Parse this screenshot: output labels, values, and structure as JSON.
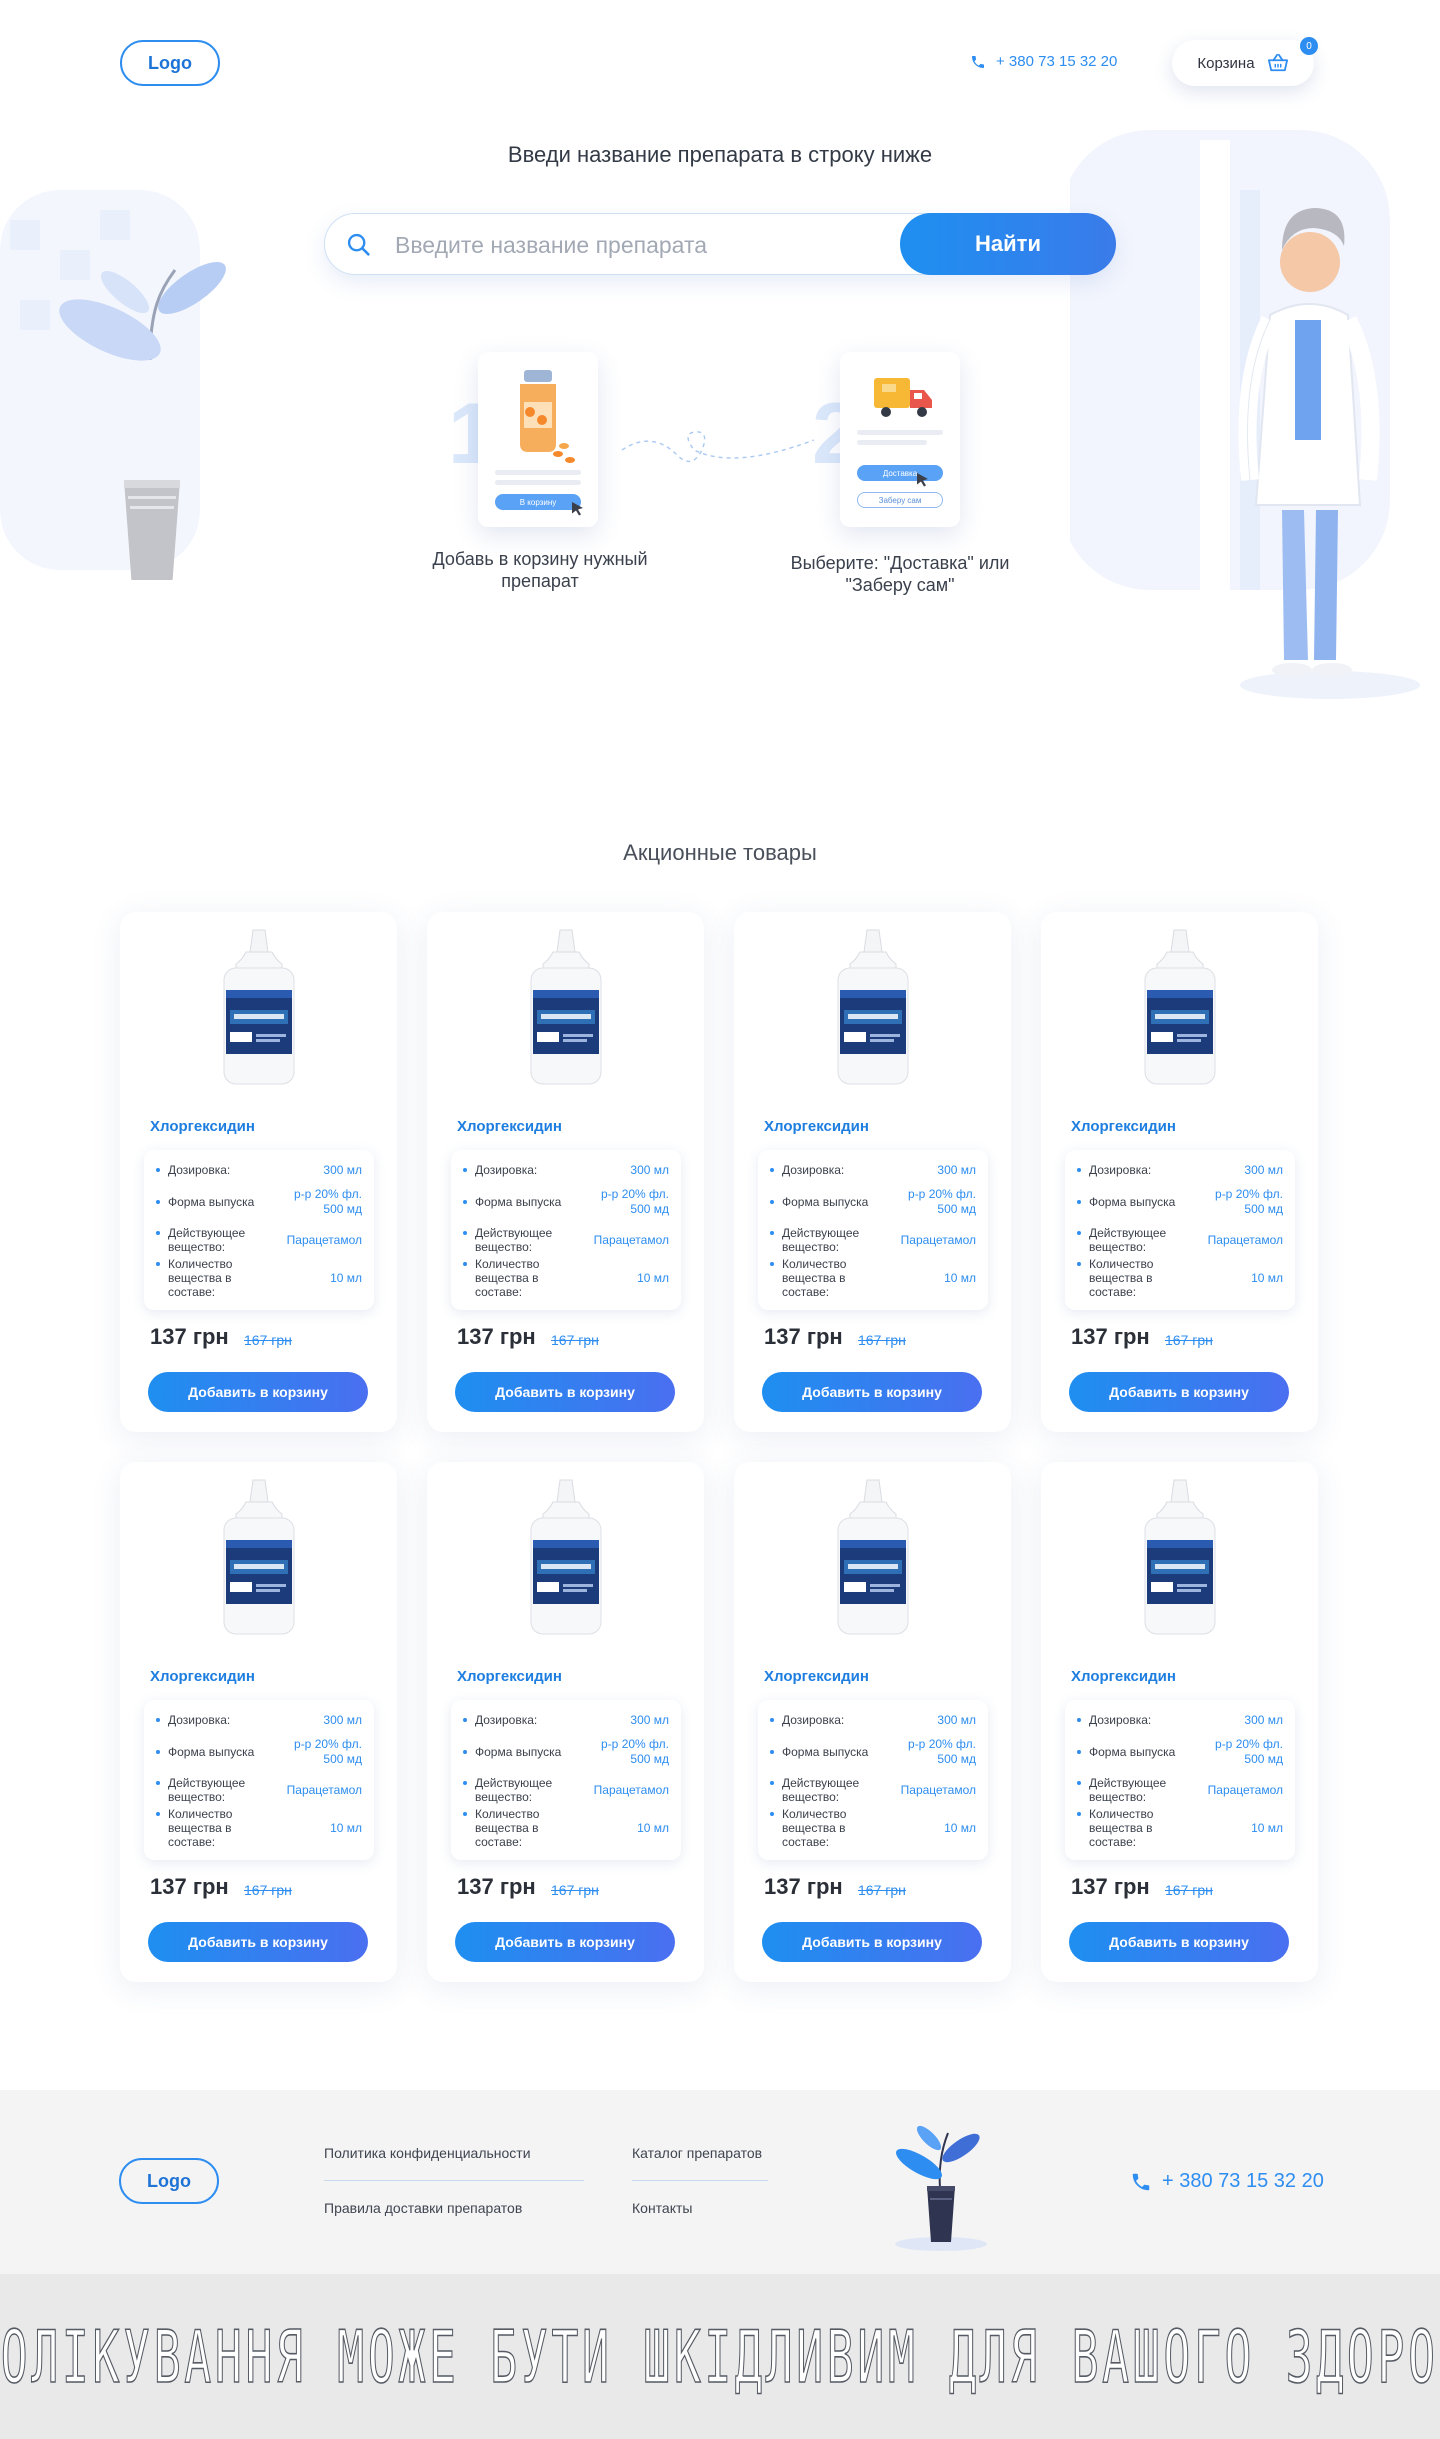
{
  "header": {
    "logo": "Logo",
    "phone": "+ 380 73 15 32 20",
    "cart_label": "Корзина",
    "cart_count": "0"
  },
  "hero": {
    "title": "Введи название препарата в строку ниже",
    "search_placeholder": "Введите название препарата",
    "search_button": "Найти",
    "steps": [
      {
        "number": "1",
        "text": "Добавь в корзину нужный препарат",
        "card_button": "В корзину"
      },
      {
        "number": "2",
        "text": "Выберите: \"Доставка\" или \"Заберу сам\"",
        "card_button": "Доставка",
        "card_button_secondary": "Заберу сам"
      }
    ]
  },
  "products_section": {
    "title": "Акционные товары",
    "spec_labels": {
      "dose": "Дозировка:",
      "form": "Форма выпуска",
      "substance": "Действующее вещество:",
      "amount": "Количество вещества в составе:"
    },
    "add_button": "Добавить в корзину",
    "items": [
      {
        "name": "Хлоргексидин",
        "dose": "300 мл",
        "form": "р-р 20% фл. 500 мд",
        "substance": "Парацетамол",
        "amount": "10 мл",
        "price": "137 грн",
        "old_price": "167 грн"
      },
      {
        "name": "Хлоргексидин",
        "dose": "300 мл",
        "form": "р-р 20% фл. 500 мд",
        "substance": "Парацетамол",
        "amount": "10 мл",
        "price": "137 грн",
        "old_price": "167 грн"
      },
      {
        "name": "Хлоргексидин",
        "dose": "300 мл",
        "form": "р-р 20% фл. 500 мд",
        "substance": "Парацетамол",
        "amount": "10 мл",
        "price": "137 грн",
        "old_price": "167 грн"
      },
      {
        "name": "Хлоргексидин",
        "dose": "300 мл",
        "form": "р-р 20% фл. 500 мд",
        "substance": "Парацетамол",
        "amount": "10 мл",
        "price": "137 грн",
        "old_price": "167 грн"
      },
      {
        "name": "Хлоргексидин",
        "dose": "300 мл",
        "form": "р-р 20% фл. 500 мд",
        "substance": "Парацетамол",
        "amount": "10 мл",
        "price": "137 грн",
        "old_price": "167 грн"
      },
      {
        "name": "Хлоргексидин",
        "dose": "300 мл",
        "form": "р-р 20% фл. 500 мд",
        "substance": "Парацетамол",
        "amount": "10 мл",
        "price": "137 грн",
        "old_price": "167 грн"
      },
      {
        "name": "Хлоргексидин",
        "dose": "300 мл",
        "form": "р-р 20% фл. 500 мд",
        "substance": "Парацетамол",
        "amount": "10 мл",
        "price": "137 грн",
        "old_price": "167 грн"
      },
      {
        "name": "Хлоргексидин",
        "dose": "300 мл",
        "form": "р-р 20% фл. 500 мд",
        "substance": "Парацетамол",
        "amount": "10 мл",
        "price": "137 грн",
        "old_price": "167 грн"
      }
    ]
  },
  "footer": {
    "logo": "Logo",
    "links": [
      "Политика конфиденциальности",
      "Правила доставки препаратов",
      "Каталог препаратов",
      "Контакты"
    ],
    "phone": "+ 380 73 15 32 20",
    "warning": "САМОЛІКУВАННЯ МОЖЕ БУТИ ШКІДЛИВИМ ДЛЯ ВАШОГО ЗДОРОВ'Я"
  },
  "colors": {
    "accent": "#2d8df0",
    "accent_dark": "#1e74d6",
    "footer_bg": "#f4f4f5"
  }
}
